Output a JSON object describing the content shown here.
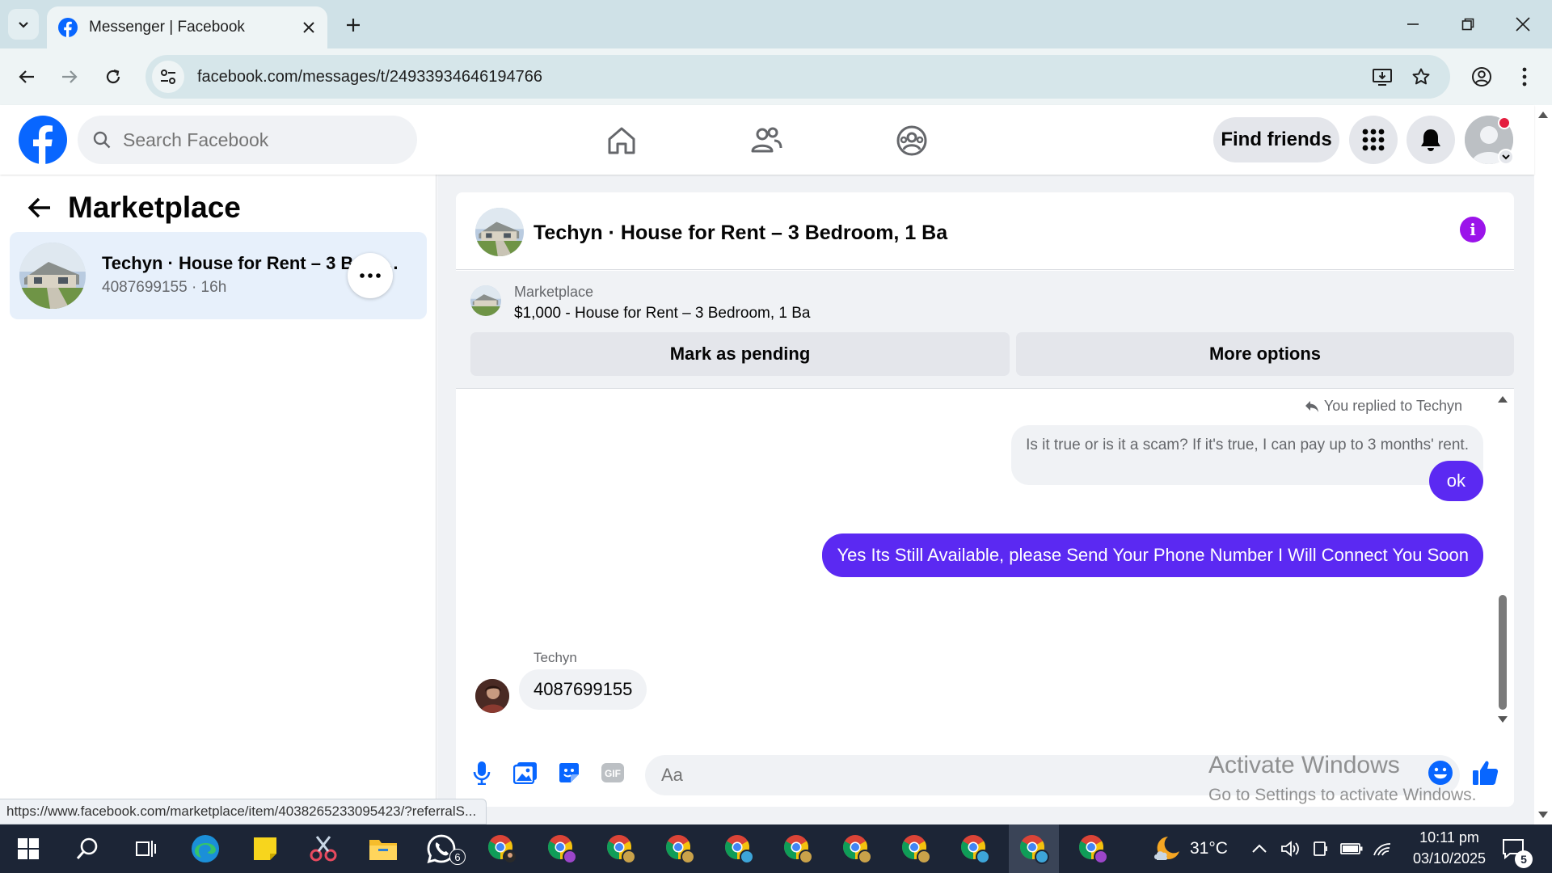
{
  "browser": {
    "tab_title": "Messenger | Facebook",
    "url": "facebook.com/messages/t/24933934646194766",
    "status_url": "https://www.facebook.com/marketplace/item/4038265233095423/?referralS..."
  },
  "header": {
    "search_placeholder": "Search Facebook",
    "find_friends_label": "Find friends"
  },
  "left_panel": {
    "title": "Marketplace",
    "conversation": {
      "name": "Techyn · House for Rent – 3 Bedroom, 1 Ba",
      "subtitle": "4087699155 · 16h"
    }
  },
  "chat": {
    "title": "Techyn · House for Rent – 3 Bedroom, 1 Ba",
    "marketplace_label": "Marketplace",
    "listing": "$1,000 - House for Rent – 3 Bedroom, 1 Ba",
    "mark_pending_label": "Mark as pending",
    "more_options_label": "More options",
    "replied_label": "You replied to Techyn",
    "quoted_message": "Is it true or is it a scam? If it's true, I can pay up to 3 months' rent.",
    "outgoing_messages": [
      "ok",
      "Yes Its Still Available, please Send Your Phone Number I Will Connect You Soon"
    ],
    "sender_name": "Techyn",
    "incoming_message": "4087699155",
    "composer_placeholder": "Aa"
  },
  "watermark": {
    "line1": "Activate Windows",
    "line2": "Go to Settings to activate Windows."
  },
  "taskbar": {
    "weather": "31°C",
    "time": "10:11 pm",
    "date": "03/10/2025",
    "whatsapp_badge": "6",
    "notification_count": "5"
  },
  "colors": {
    "fb_blue": "#0866ff",
    "messenger_purple": "#5b29f2",
    "info_purple": "#9b14ea",
    "notif_red": "#e41e3f"
  }
}
